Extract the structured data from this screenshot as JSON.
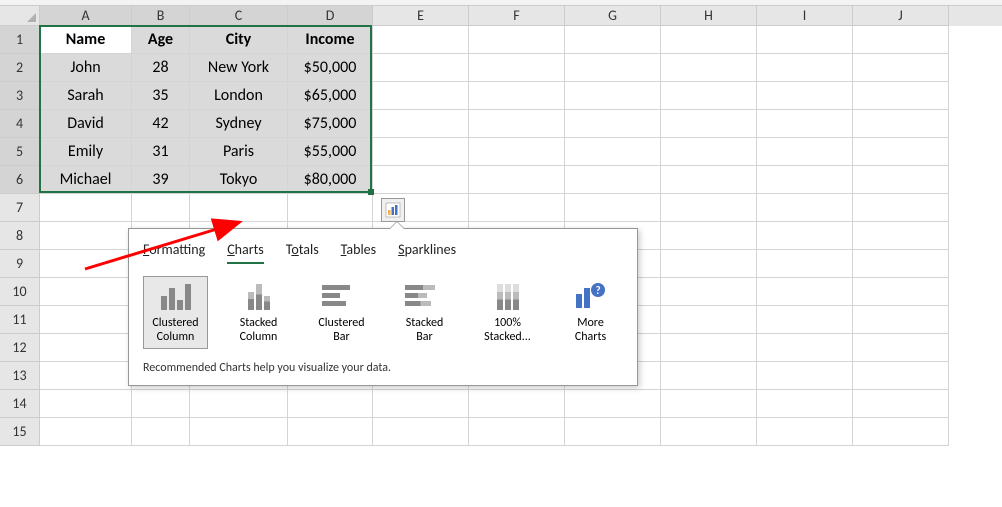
{
  "columns": [
    "A",
    "B",
    "C",
    "D",
    "E",
    "F",
    "G",
    "H",
    "I",
    "J"
  ],
  "rowCount": 15,
  "table": {
    "headers": [
      "Name",
      "Age",
      "City",
      "Income"
    ],
    "rows": [
      [
        "John",
        "28",
        "New York",
        "$50,000"
      ],
      [
        "Sarah",
        "35",
        "London",
        "$65,000"
      ],
      [
        "David",
        "42",
        "Sydney",
        "$75,000"
      ],
      [
        "Emily",
        "31",
        "Paris",
        "$55,000"
      ],
      [
        "Michael",
        "39",
        "Tokyo",
        "$80,000"
      ]
    ]
  },
  "selection": {
    "startCol": 0,
    "endCol": 3,
    "startRow": 1,
    "endRow": 6
  },
  "quickAnalysis": {
    "tabs": [
      {
        "label": "Formatting",
        "accel": "F"
      },
      {
        "label": "Charts",
        "accel": "C"
      },
      {
        "label": "Totals",
        "accel": "o"
      },
      {
        "label": "Tables",
        "accel": "T"
      },
      {
        "label": "Sparklines",
        "accel": "S"
      }
    ],
    "activeTab": 1,
    "options": [
      {
        "label": "Clustered Column"
      },
      {
        "label": "Stacked Column"
      },
      {
        "label": "Clustered Bar"
      },
      {
        "label": "Stacked Bar"
      },
      {
        "label": "100% Stacked..."
      },
      {
        "label": "More Charts"
      }
    ],
    "selectedOption": 0,
    "footer": "Recommended Charts help you visualize your data."
  }
}
